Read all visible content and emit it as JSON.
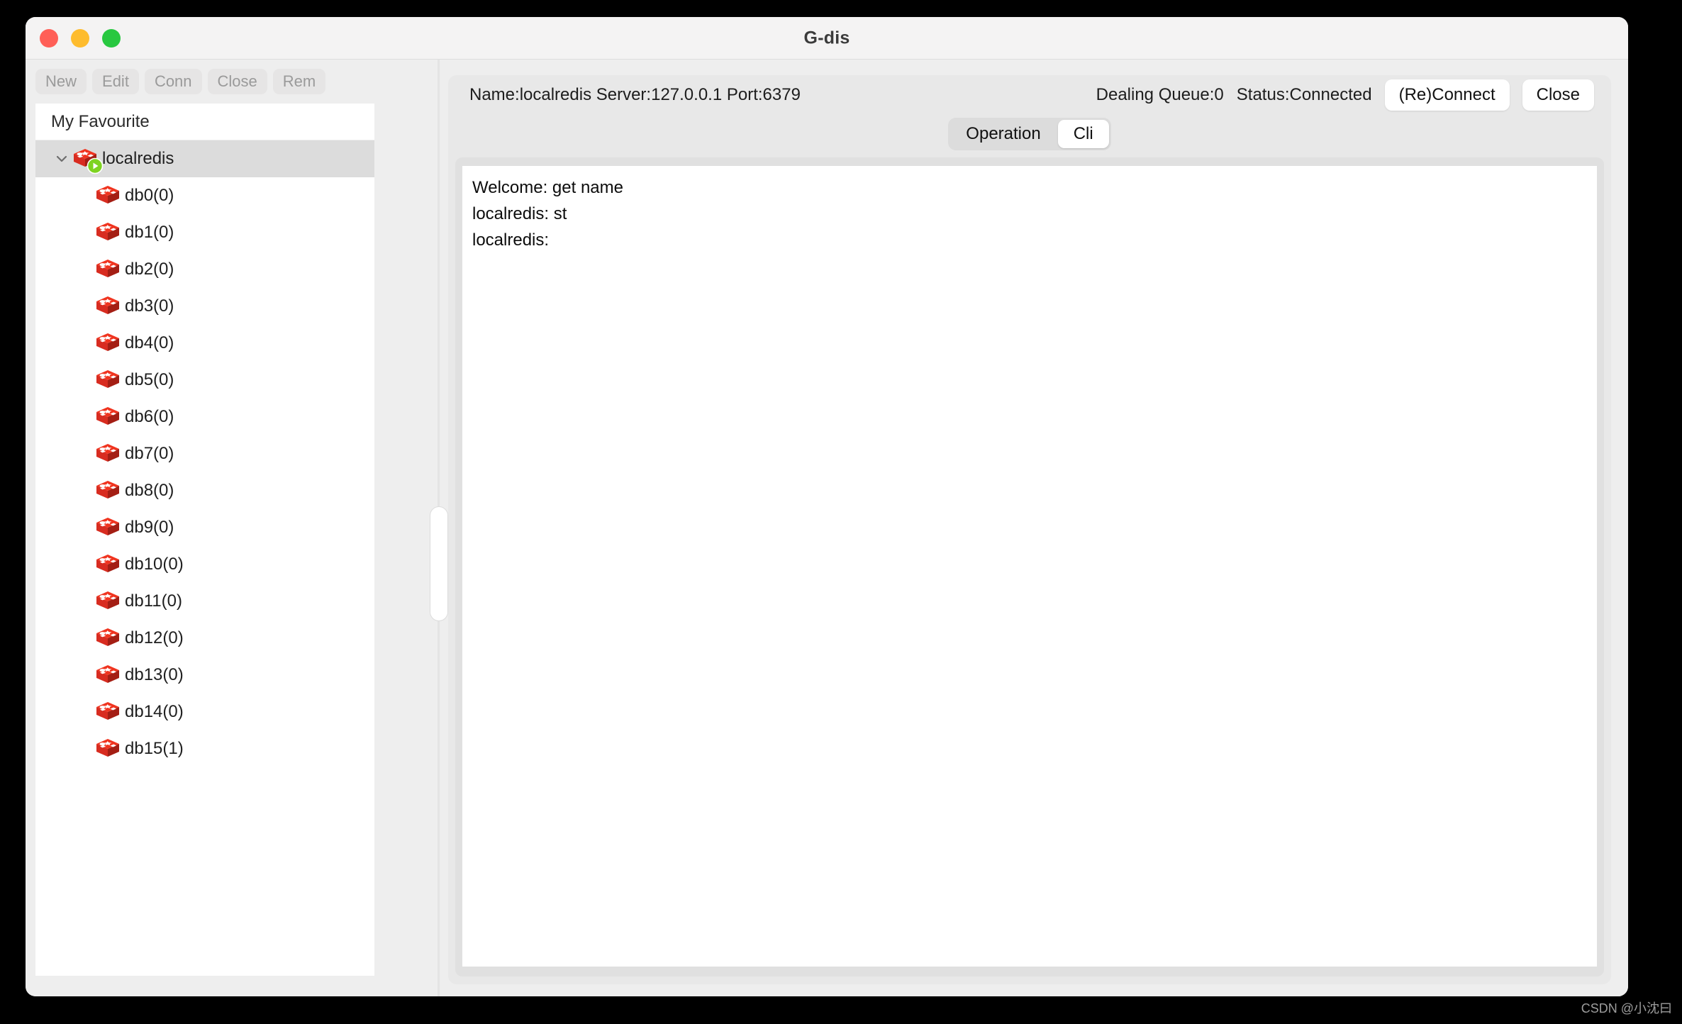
{
  "window": {
    "title": "G-dis",
    "traffic_lights": [
      {
        "name": "close",
        "color": "#ff5f57"
      },
      {
        "name": "minimize",
        "color": "#febc2e"
      },
      {
        "name": "zoom",
        "color": "#28c840"
      }
    ]
  },
  "toolbar": {
    "buttons": [
      {
        "label": "New",
        "enabled": false
      },
      {
        "label": "Edit",
        "enabled": false
      },
      {
        "label": "Conn",
        "enabled": false
      },
      {
        "label": "Close",
        "enabled": false
      },
      {
        "label": "Rem",
        "enabled": false
      }
    ]
  },
  "sidebar": {
    "header": "My Favourite",
    "root": {
      "label": "localredis",
      "expanded": true,
      "selected": true,
      "icon": "redis-icon",
      "status_badge": "connected-play-badge"
    },
    "databases": [
      {
        "label": "db0(0)",
        "icon": "redis-icon"
      },
      {
        "label": "db1(0)",
        "icon": "redis-icon"
      },
      {
        "label": "db2(0)",
        "icon": "redis-icon"
      },
      {
        "label": "db3(0)",
        "icon": "redis-icon"
      },
      {
        "label": "db4(0)",
        "icon": "redis-icon"
      },
      {
        "label": "db5(0)",
        "icon": "redis-icon"
      },
      {
        "label": "db6(0)",
        "icon": "redis-icon"
      },
      {
        "label": "db7(0)",
        "icon": "redis-icon"
      },
      {
        "label": "db8(0)",
        "icon": "redis-icon"
      },
      {
        "label": "db9(0)",
        "icon": "redis-icon"
      },
      {
        "label": "db10(0)",
        "icon": "redis-icon"
      },
      {
        "label": "db11(0)",
        "icon": "redis-icon"
      },
      {
        "label": "db12(0)",
        "icon": "redis-icon"
      },
      {
        "label": "db13(0)",
        "icon": "redis-icon"
      },
      {
        "label": "db14(0)",
        "icon": "redis-icon"
      },
      {
        "label": "db15(1)",
        "icon": "redis-icon"
      }
    ]
  },
  "connection": {
    "info": "Name:localredis Server:127.0.0.1 Port:6379",
    "dealing_queue": "Dealing Queue:0",
    "status": "Status:Connected",
    "reconnect_label": "(Re)Connect",
    "close_label": "Close"
  },
  "tabs": {
    "items": [
      {
        "label": "Operation",
        "active": false
      },
      {
        "label": "Cli",
        "active": true
      }
    ]
  },
  "console": {
    "lines": [
      "Welcome: get name",
      "localredis: st",
      "localredis:"
    ],
    "text": "Welcome: get name\nlocalredis: st\nlocalredis:"
  },
  "watermark": "CSDN @小沈曰",
  "colors": {
    "window_bg": "#eeeeee",
    "titlebar": "#f4f3f3",
    "panel_bg": "#e8e8e8",
    "console_bg": "#ffffff",
    "selection": "#dcdcdc",
    "redis_red": "#d82c20"
  }
}
